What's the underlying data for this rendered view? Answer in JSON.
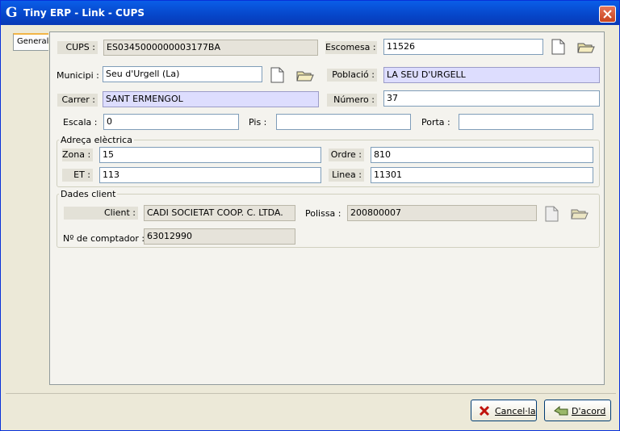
{
  "window": {
    "title": "Tiny ERP - Link - CUPS",
    "app_icon_letter": "G"
  },
  "tabs": [
    {
      "label": "General"
    }
  ],
  "fields": {
    "cups": {
      "label": "CUPS :",
      "value": "ES0345000000003177BA"
    },
    "escomesa": {
      "label": "Escomesa :",
      "value": "11526"
    },
    "municipi": {
      "label": "Municipi :",
      "value": "Seu d'Urgell (La)"
    },
    "poblacio": {
      "label": "Població :",
      "value": "LA SEU D'URGELL"
    },
    "carrer": {
      "label": "Carrer :",
      "value": "SANT ERMENGOL"
    },
    "numero": {
      "label": "Número :",
      "value": "37"
    },
    "escala": {
      "label": "Escala :",
      "value": "0"
    },
    "pis": {
      "label": "Pis :",
      "value": ""
    },
    "porta": {
      "label": "Porta :",
      "value": ""
    }
  },
  "adreca": {
    "legend": "Adreça elèctrica",
    "zona": {
      "label": "Zona :",
      "value": "15"
    },
    "ordre": {
      "label": "Ordre :",
      "value": "810"
    },
    "et": {
      "label": "ET :",
      "value": "113"
    },
    "linea": {
      "label": "Linea :",
      "value": "11301"
    }
  },
  "dades_client": {
    "legend": "Dades client",
    "client": {
      "label": "Client :",
      "value": "CADI SOCIETAT COOP. C. LTDA."
    },
    "polissa": {
      "label": "Polissa :",
      "value": "200800007"
    },
    "comptador": {
      "label": "Nº de comptador :",
      "value": "63012990"
    }
  },
  "buttons": {
    "cancel": "Cancel·la",
    "ok": "D'acord"
  }
}
